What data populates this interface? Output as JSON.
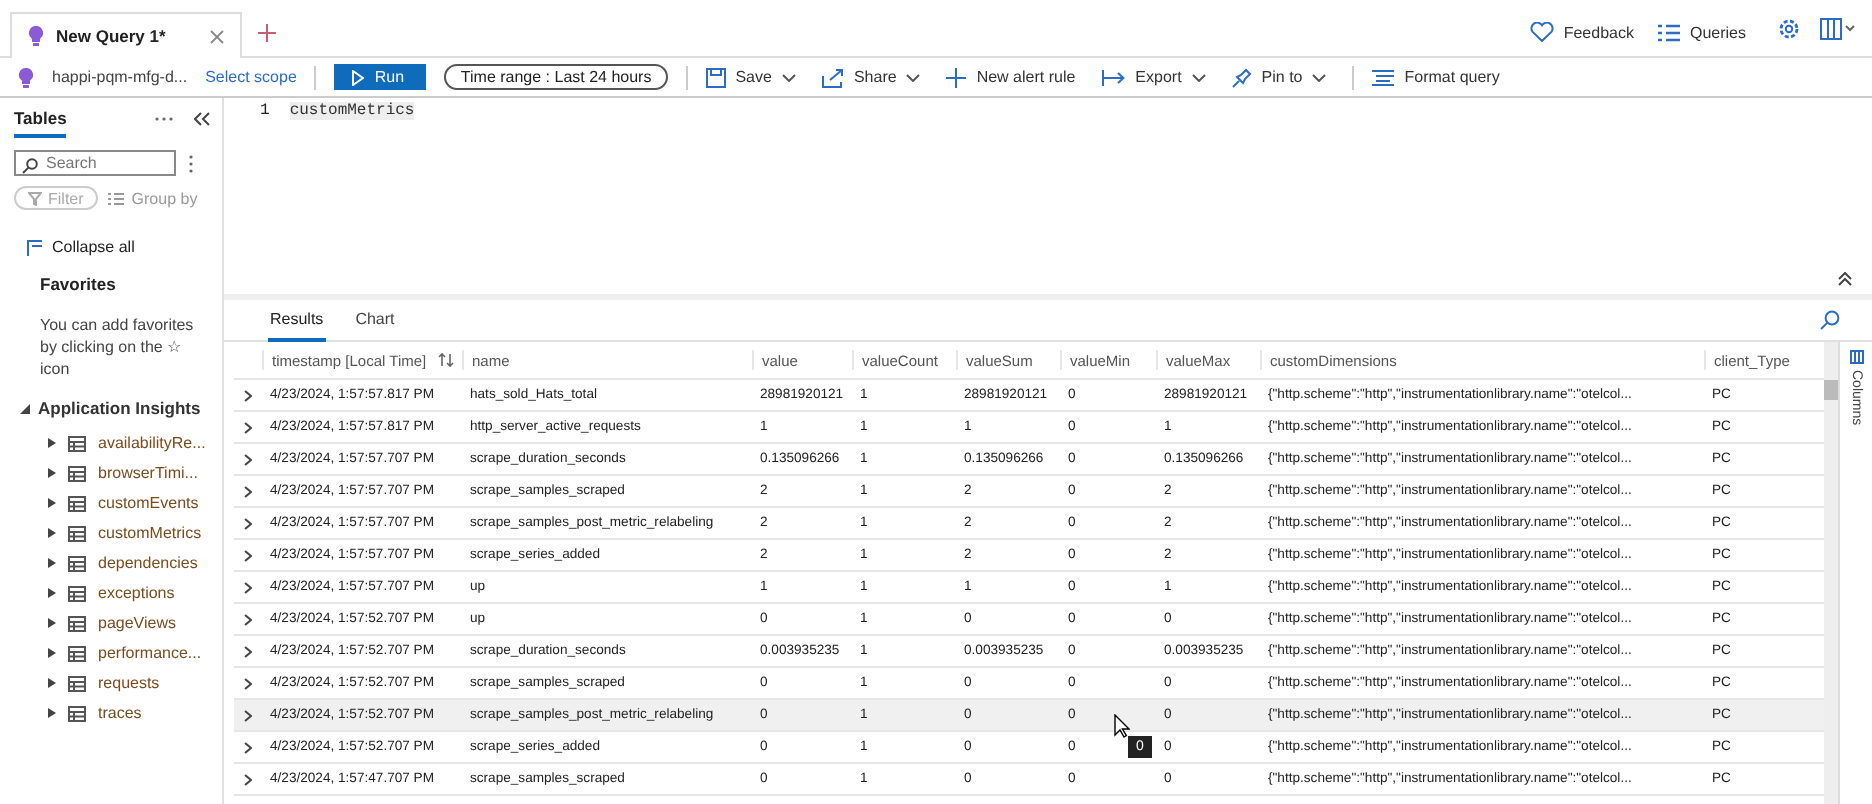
{
  "tabs": [
    {
      "label": "New Query 1*",
      "selected": true
    }
  ],
  "header_links": [
    {
      "label": "Feedback"
    },
    {
      "label": "Queries"
    }
  ],
  "toolbar": {
    "scope": "happi-pqm-mfg-d...",
    "select_scope": "Select scope",
    "run": "Run",
    "time_range": "Time range :  Last 24 hours",
    "actions": [
      {
        "label": "Save",
        "dropdown": true
      },
      {
        "label": "Share",
        "dropdown": true
      },
      {
        "label": "New alert rule",
        "dropdown": false
      },
      {
        "label": "Export",
        "dropdown": true
      },
      {
        "label": "Pin to",
        "dropdown": true
      },
      {
        "label": "Format query",
        "dropdown": false
      }
    ]
  },
  "sidebar": {
    "title": "Tables",
    "search_placeholder": "Search",
    "filter": "Filter",
    "group_by": "Group by",
    "collapse_all": "Collapse all",
    "favorites_title": "Favorites",
    "favorites_text": "You can add favorites by clicking on the ☆ icon",
    "tree": [
      {
        "label": "Application Insights",
        "expanded": true,
        "children": [
          {
            "label": "availabilityRe...",
            "expanded": false
          },
          {
            "label": "browserTimi...",
            "expanded": false
          },
          {
            "label": "customEvents",
            "expanded": false
          },
          {
            "label": "customMetrics",
            "expanded": false
          },
          {
            "label": "dependencies",
            "expanded": false
          },
          {
            "label": "exceptions",
            "expanded": false
          },
          {
            "label": "pageViews",
            "expanded": false
          },
          {
            "label": "performance...",
            "expanded": false
          },
          {
            "label": "requests",
            "expanded": false
          },
          {
            "label": "traces",
            "expanded": false
          }
        ]
      }
    ]
  },
  "editor": {
    "lines": [
      {
        "number": "1",
        "code": "customMetrics"
      }
    ]
  },
  "results_tabs": [
    {
      "label": "Results",
      "selected": true
    },
    {
      "label": "Chart",
      "selected": false
    }
  ],
  "table": {
    "columns": [
      "timestamp [Local Time]",
      "name",
      "value",
      "valueCount",
      "valueSum",
      "valueMin",
      "valueMax",
      "customDimensions",
      "client_Type"
    ],
    "rows": [
      {
        "selected": false,
        "cells": [
          "4/23/2024, 1:57:57.817 PM",
          "hats_sold_Hats_total",
          "28981920121",
          "1",
          "28981920121",
          "0",
          "28981920121",
          "{\"http.scheme\":\"http\",\"instrumentationlibrary.name\":\"otelcol...",
          "PC"
        ]
      },
      {
        "selected": false,
        "cells": [
          "4/23/2024, 1:57:57.817 PM",
          "http_server_active_requests",
          "1",
          "1",
          "1",
          "0",
          "1",
          "{\"http.scheme\":\"http\",\"instrumentationlibrary.name\":\"otelcol...",
          "PC"
        ]
      },
      {
        "selected": false,
        "cells": [
          "4/23/2024, 1:57:57.707 PM",
          "scrape_duration_seconds",
          "0.135096266",
          "1",
          "0.135096266",
          "0",
          "0.135096266",
          "{\"http.scheme\":\"http\",\"instrumentationlibrary.name\":\"otelcol...",
          "PC"
        ]
      },
      {
        "selected": false,
        "cells": [
          "4/23/2024, 1:57:57.707 PM",
          "scrape_samples_scraped",
          "2",
          "1",
          "2",
          "0",
          "2",
          "{\"http.scheme\":\"http\",\"instrumentationlibrary.name\":\"otelcol...",
          "PC"
        ]
      },
      {
        "selected": false,
        "cells": [
          "4/23/2024, 1:57:57.707 PM",
          "scrape_samples_post_metric_relabeling",
          "2",
          "1",
          "2",
          "0",
          "2",
          "{\"http.scheme\":\"http\",\"instrumentationlibrary.name\":\"otelcol...",
          "PC"
        ]
      },
      {
        "selected": false,
        "cells": [
          "4/23/2024, 1:57:57.707 PM",
          "scrape_series_added",
          "2",
          "1",
          "2",
          "0",
          "2",
          "{\"http.scheme\":\"http\",\"instrumentationlibrary.name\":\"otelcol...",
          "PC"
        ]
      },
      {
        "selected": false,
        "cells": [
          "4/23/2024, 1:57:57.707 PM",
          "up",
          "1",
          "1",
          "1",
          "0",
          "1",
          "{\"http.scheme\":\"http\",\"instrumentationlibrary.name\":\"otelcol...",
          "PC"
        ]
      },
      {
        "selected": false,
        "cells": [
          "4/23/2024, 1:57:52.707 PM",
          "up",
          "0",
          "1",
          "0",
          "0",
          "0",
          "{\"http.scheme\":\"http\",\"instrumentationlibrary.name\":\"otelcol...",
          "PC"
        ]
      },
      {
        "selected": false,
        "cells": [
          "4/23/2024, 1:57:52.707 PM",
          "scrape_duration_seconds",
          "0.003935235",
          "1",
          "0.003935235",
          "0",
          "0.003935235",
          "{\"http.scheme\":\"http\",\"instrumentationlibrary.name\":\"otelcol...",
          "PC"
        ]
      },
      {
        "selected": false,
        "cells": [
          "4/23/2024, 1:57:52.707 PM",
          "scrape_samples_scraped",
          "0",
          "1",
          "0",
          "0",
          "0",
          "{\"http.scheme\":\"http\",\"instrumentationlibrary.name\":\"otelcol...",
          "PC"
        ]
      },
      {
        "selected": true,
        "cells": [
          "4/23/2024, 1:57:52.707 PM",
          "scrape_samples_post_metric_relabeling",
          "0",
          "1",
          "0",
          "0",
          "0",
          "{\"http.scheme\":\"http\",\"instrumentationlibrary.name\":\"otelcol...",
          "PC"
        ]
      },
      {
        "selected": false,
        "cells": [
          "4/23/2024, 1:57:52.707 PM",
          "scrape_series_added",
          "0",
          "1",
          "0",
          "0",
          "0",
          "{\"http.scheme\":\"http\",\"instrumentationlibrary.name\":\"otelcol...",
          "PC"
        ]
      },
      {
        "selected": false,
        "cells": [
          "4/23/2024, 1:57:47.707 PM",
          "scrape_samples_scraped",
          "0",
          "1",
          "0",
          "0",
          "0",
          "{\"http.scheme\":\"http\",\"instrumentationlibrary.name\":\"otelcol...",
          "PC"
        ]
      }
    ]
  },
  "tooltip": "0",
  "columns_panel": "Columns"
}
